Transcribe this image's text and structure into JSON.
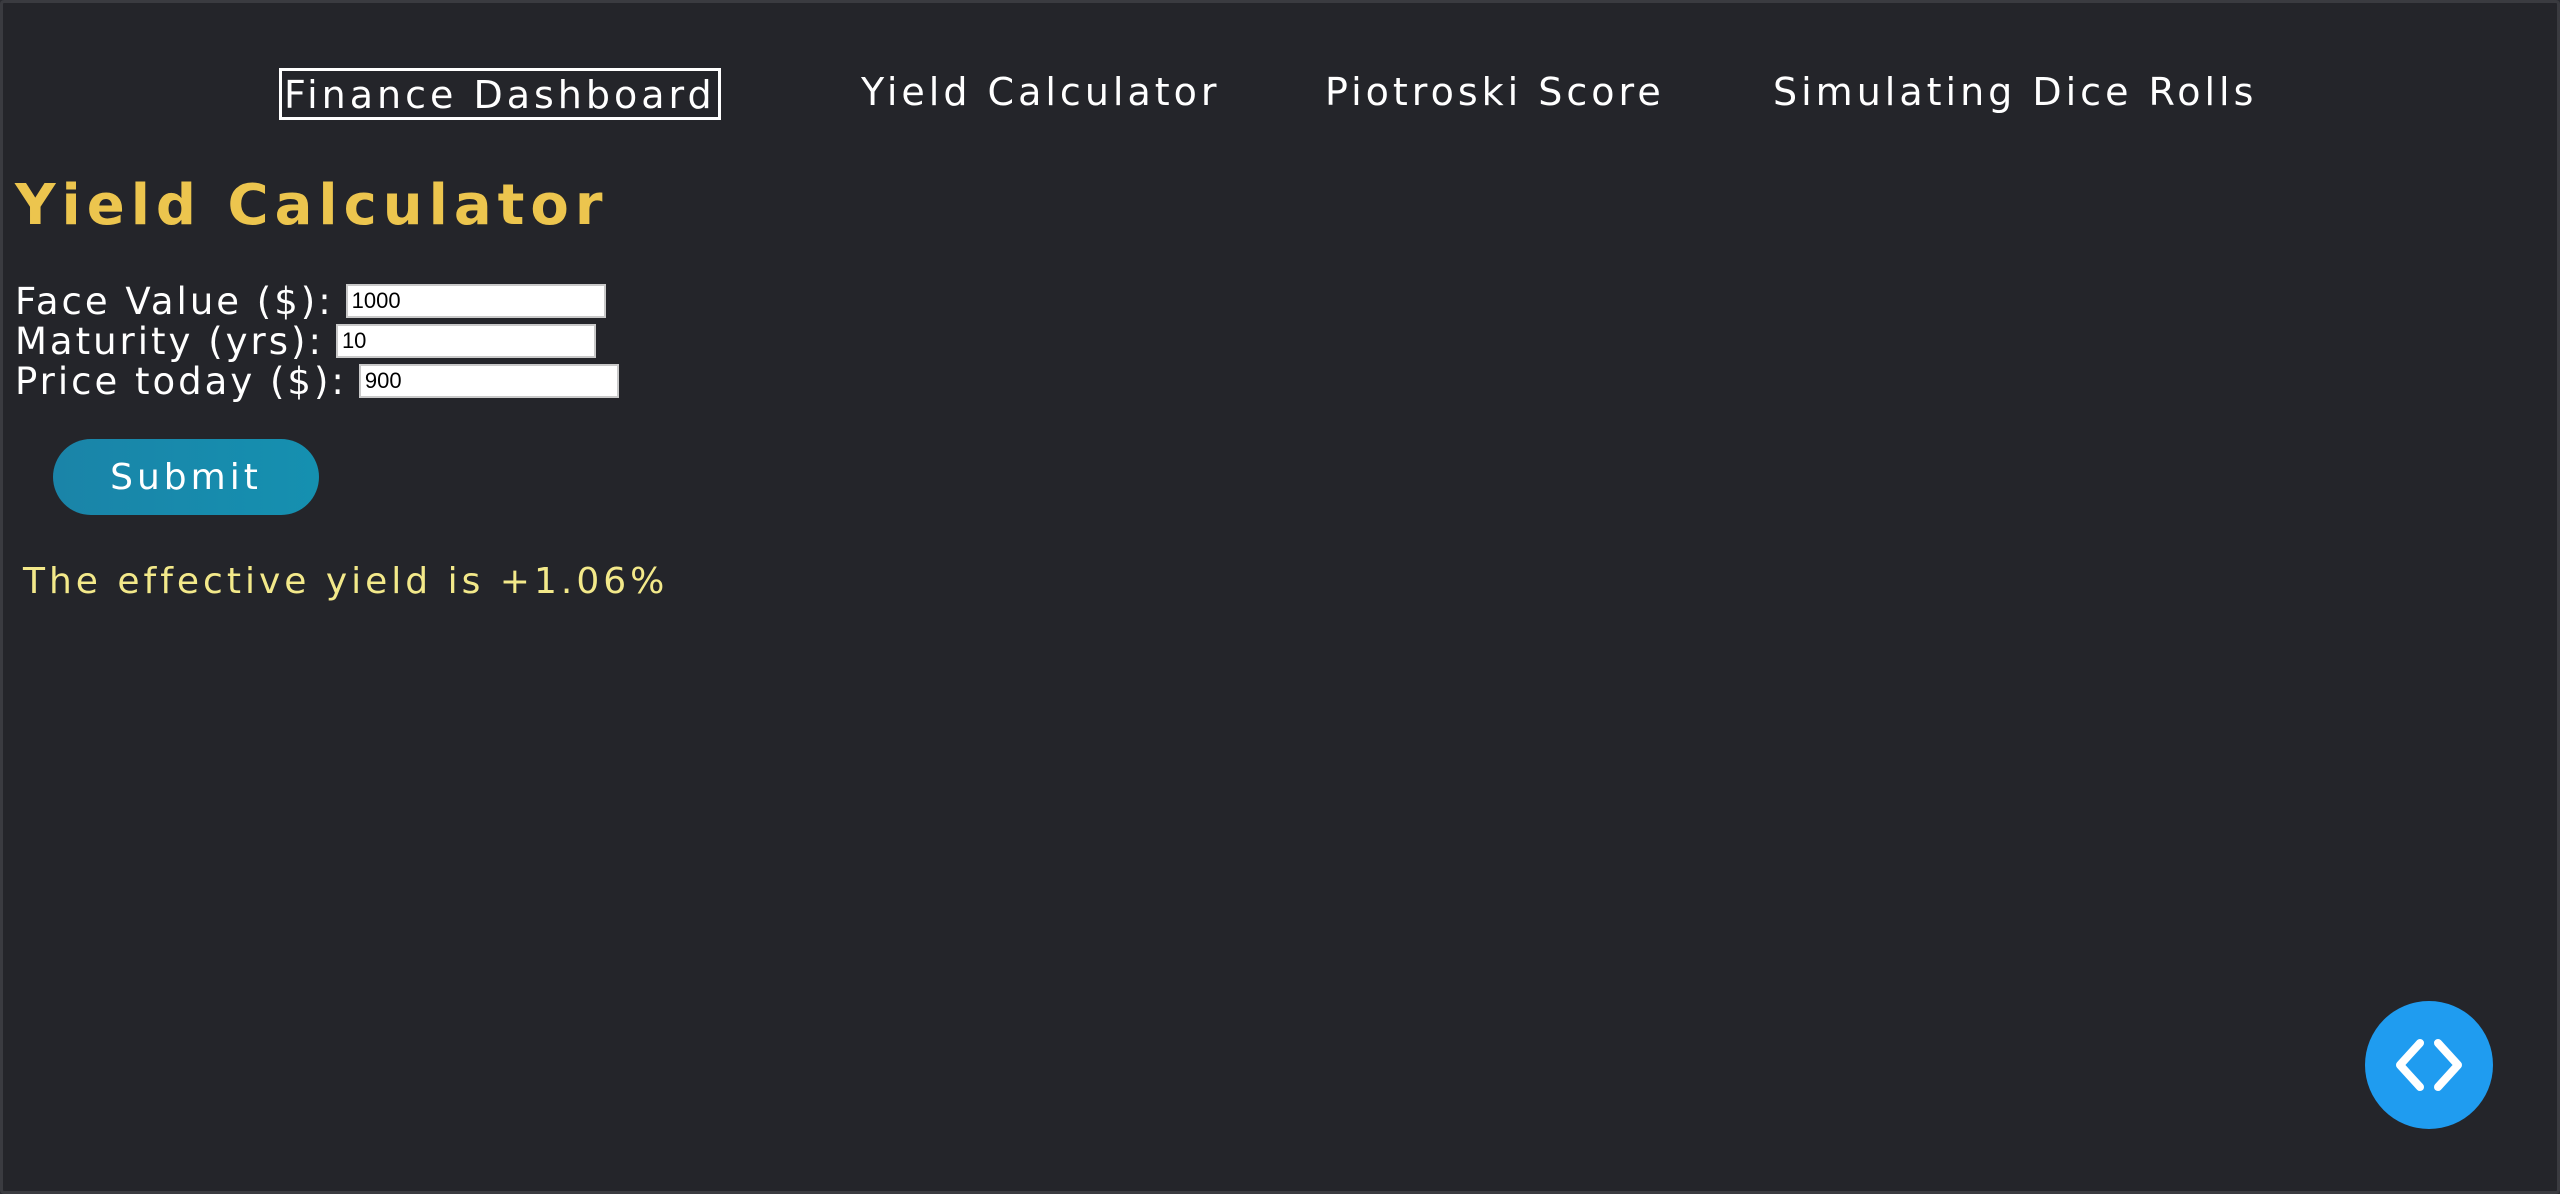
{
  "nav": {
    "items": [
      {
        "label": "Finance Dashboard",
        "active": true
      },
      {
        "label": "Yield Calculator",
        "active": false
      },
      {
        "label": "Piotroski Score",
        "active": false
      },
      {
        "label": "Simulating Dice Rolls",
        "active": false
      }
    ]
  },
  "page": {
    "title": "Yield Calculator"
  },
  "form": {
    "face_value": {
      "label": "Face Value ($):",
      "value": "1000"
    },
    "maturity": {
      "label": "Maturity (yrs):",
      "value": "10"
    },
    "price_today": {
      "label": "Price today ($):",
      "value": "900"
    },
    "submit_label": "Submit"
  },
  "result": {
    "text": "The effective yield is +1.06%"
  },
  "fab": {
    "icon": "code-brackets-icon"
  },
  "colors": {
    "background": "#24252a",
    "title": "#ecc54e",
    "result": "#f3e98a",
    "button": "#1a84a8",
    "fab": "#1f9cf0"
  }
}
